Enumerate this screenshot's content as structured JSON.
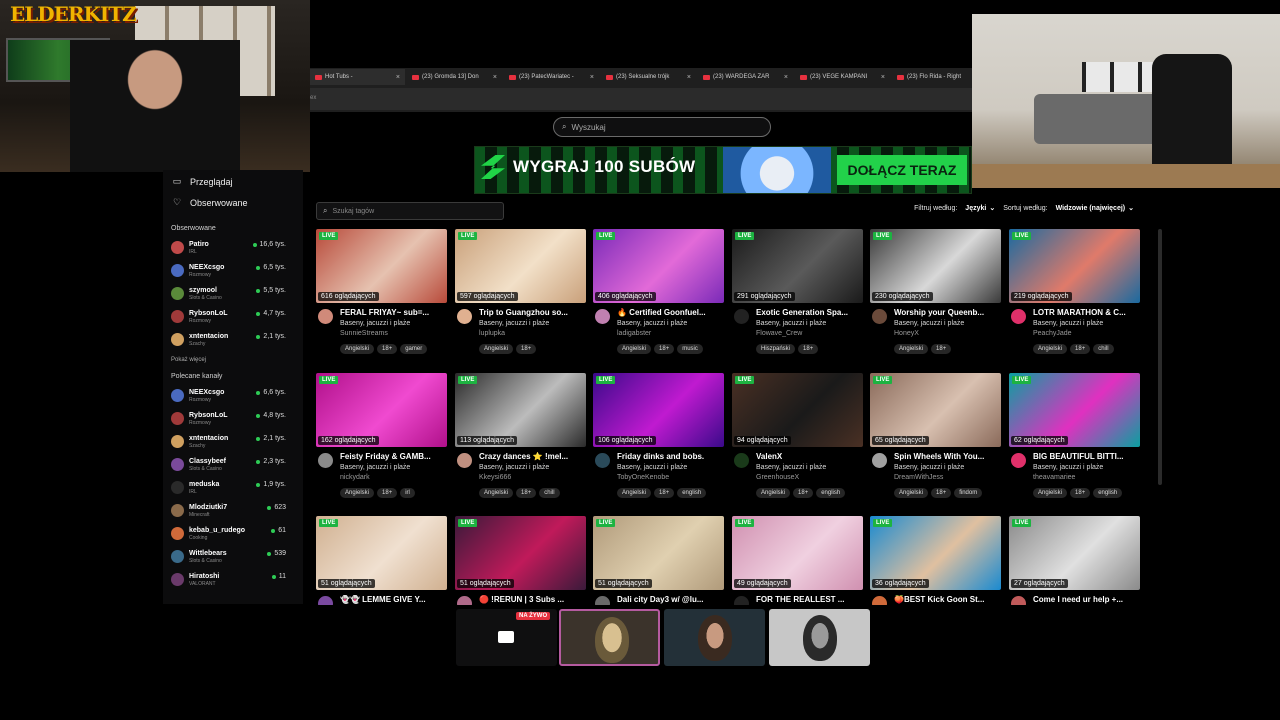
{
  "overlay": {
    "streamer_logo": "ELDERKITZ"
  },
  "browser": {
    "tabs": [
      {
        "label": "Hot Tubs - ",
        "active": true
      },
      {
        "label": "(23) Gromda 13] Don"
      },
      {
        "label": "(23) PatecWariatec - "
      },
      {
        "label": "(23) Seksualne trójk"
      },
      {
        "label": "(23) WARDEGA ZAR"
      },
      {
        "label": "(23) VEGE KAMPANI"
      },
      {
        "label": "(23) Flo Rida - Right "
      }
    ],
    "address_fragment": "ex"
  },
  "search": {
    "placeholder": "Wyszukaj"
  },
  "banner": {
    "headline": "WYGRAJ 100 SUBÓW",
    "cta": "DOŁĄCZ TERAZ",
    "accent": "#22d14a"
  },
  "sidebar": {
    "nav": [
      {
        "label": "Przeglądaj",
        "icon": "browse-icon"
      },
      {
        "label": "Obserwowane",
        "icon": "heart-icon"
      }
    ],
    "followed_header": "Obserwowane",
    "followed": [
      {
        "name": "Patiro",
        "category": "IRL",
        "viewers": "16,6 tys.",
        "color": "#c04a4a"
      },
      {
        "name": "NEEXcsgo",
        "category": "Rozmowy",
        "viewers": "6,5 tys.",
        "color": "#4a6ac0"
      },
      {
        "name": "szymool",
        "category": "Slots & Casino",
        "viewers": "5,5 tys.",
        "color": "#5a8a3a"
      },
      {
        "name": "RybsonLoL",
        "category": "Rozmowy",
        "viewers": "4,7 tys.",
        "color": "#a03a3a"
      },
      {
        "name": "xntentacion",
        "category": "Szachy",
        "viewers": "2,1 tys.",
        "color": "#d0a060"
      }
    ],
    "show_more": "Pokaż więcej",
    "recommended_header": "Polecane kanały",
    "recommended": [
      {
        "name": "NEEXcsgo",
        "category": "Rozmowy",
        "viewers": "6,6 tys.",
        "color": "#4a6ac0"
      },
      {
        "name": "RybsonLoL",
        "category": "Rozmowy",
        "viewers": "4,8 tys.",
        "color": "#a03a3a"
      },
      {
        "name": "xntentacion",
        "category": "Szachy",
        "viewers": "2,1 tys.",
        "color": "#d0a060"
      },
      {
        "name": "Classybeef",
        "category": "Slots & Casino",
        "viewers": "2,3 tys.",
        "color": "#7a4a9a"
      },
      {
        "name": "meduska",
        "category": "IRL",
        "viewers": "1,9 tys.",
        "color": "#2a2a2a"
      },
      {
        "name": "Mlodziutki7",
        "category": "Minecraft",
        "viewers": "623",
        "color": "#8a6a4a"
      },
      {
        "name": "kebab_u_rudego",
        "category": "Cooking",
        "viewers": "61",
        "color": "#d06a3a"
      },
      {
        "name": "Wittlebears",
        "category": "Slots & Casino",
        "viewers": "539",
        "color": "#3a6a8a"
      },
      {
        "name": "Hiratoshi",
        "category": "VALORANT",
        "viewers": "11",
        "color": "#6a3a6a"
      }
    ]
  },
  "filters": {
    "tag_search_placeholder": "Szukaj tagów",
    "filter_label": "Filtruj według:",
    "filter_value": "Języki",
    "sort_label": "Sortuj według:",
    "sort_value": "Widzowie (najwięcej)"
  },
  "live_label": "LIVE",
  "streams": [
    {
      "title": "FERAL FRIYAY~ sub=...",
      "category": "Baseny, jacuzzi i plaże",
      "user": "SunnieStreams",
      "viewers": "616 oglądających",
      "tags": [
        "Angielski",
        "18+",
        "gamer"
      ],
      "c1": "#b84a3a",
      "c2": "#e6c2b0",
      "av": "#d08a7a"
    },
    {
      "title": "Trip to Guangzhou so...",
      "category": "Baseny, jacuzzi i plaże",
      "user": "luplupka",
      "viewers": "597 oglądających",
      "tags": [
        "Angielski",
        "18+"
      ],
      "c1": "#c9a07a",
      "c2": "#f2e0c8",
      "av": "#e0b090"
    },
    {
      "title": "🔥 Certified Goonfuel...",
      "category": "Baseny, jacuzzi i plaże",
      "user": "ladigabster",
      "viewers": "406 oglądających",
      "tags": [
        "Angielski",
        "18+",
        "music"
      ],
      "c1": "#7a2ab8",
      "c2": "#e26ad8",
      "av": "#c080b0"
    },
    {
      "title": "Exotic Generation Spa...",
      "category": "Baseny, jacuzzi i plaże",
      "user": "Flowave_Crew",
      "viewers": "291 oglądających",
      "tags": [
        "Hiszpański",
        "18+"
      ],
      "c1": "#1a1a1a",
      "c2": "#5a5a5a",
      "av": "#222"
    },
    {
      "title": "Worship your Queenb...",
      "category": "Baseny, jacuzzi i plaże",
      "user": "HoneyX",
      "viewers": "230 oglądających",
      "tags": [
        "Angielski",
        "18+"
      ],
      "c1": "#3a3a3a",
      "c2": "#d8d8d8",
      "av": "#6a4a3a"
    },
    {
      "title": "LOTR MARATHON & C...",
      "category": "Baseny, jacuzzi i plaże",
      "user": "PeachyJade",
      "viewers": "219 oglądających",
      "tags": [
        "Angielski",
        "18+",
        "chill"
      ],
      "c1": "#1a6aa0",
      "c2": "#e07a6a",
      "av": "#e0306a"
    },
    {
      "title": "Feisty Friday & GAMB...",
      "category": "Baseny, jacuzzi i plaże",
      "user": "nickydark",
      "viewers": "162 oglądających",
      "tags": [
        "Angielski",
        "18+",
        "irl"
      ],
      "c1": "#b0108a",
      "c2": "#f04ad0",
      "av": "#8a8a8a"
    },
    {
      "title": "Crazy dances ⭐ !mel...",
      "category": "Baseny, jacuzzi i plaże",
      "user": "Kkeysi666",
      "viewers": "113 oglądających",
      "tags": [
        "Angielski",
        "18+",
        "chill"
      ],
      "c1": "#2a2a2a",
      "c2": "#bcbcbc",
      "av": "#c09080"
    },
    {
      "title": "Friday dinks and bobs.",
      "category": "Baseny, jacuzzi i plaże",
      "user": "TobyOneKenobe",
      "viewers": "106 oglądających",
      "tags": [
        "Angielski",
        "18+",
        "english"
      ],
      "c1": "#3a0a8a",
      "c2": "#c01ad0",
      "av": "#2a4a5a"
    },
    {
      "title": "ValenX",
      "category": "Baseny, jacuzzi i plaże",
      "user": "GreenhouseX",
      "viewers": "94 oglądających",
      "tags": [
        "Angielski",
        "18+",
        "english"
      ],
      "c1": "#4a3024",
      "c2": "#1a1a1a",
      "av": "#1a3a1a"
    },
    {
      "title": "Spin Wheels With You...",
      "category": "Baseny, jacuzzi i plaże",
      "user": "DreamWithJess",
      "viewers": "65 oglądających",
      "tags": [
        "Angielski",
        "18+",
        "findom"
      ],
      "c1": "#8a6a5a",
      "c2": "#d8c0b0",
      "av": "#a0a0a0"
    },
    {
      "title": "BIG BEAUTIFUL BITTI...",
      "category": "Baseny, jacuzzi i plaże",
      "user": "theavamariee",
      "viewers": "62 oglądających",
      "tags": [
        "Angielski",
        "18+",
        "english"
      ],
      "c1": "#0aa0a0",
      "c2": "#e030c0",
      "av": "#e0306a"
    },
    {
      "title": "👻👻 LEMME GIVE Y...",
      "category": "",
      "user": "",
      "viewers": "51 oglądających",
      "tags": [],
      "c1": "#d0b090",
      "c2": "#f0e0d0",
      "av": "#7a4aa0"
    },
    {
      "title": "🔴 !RERUN | 3 Subs ...",
      "category": "",
      "user": "",
      "viewers": "51 oglądających",
      "tags": [],
      "c1": "#3a1a3a",
      "c2": "#c01a5a",
      "av": "#b06a8a"
    },
    {
      "title": "Dali city Day3 w/ @lu...",
      "category": "",
      "user": "",
      "viewers": "51 oglądających",
      "tags": [],
      "c1": "#b09a7a",
      "c2": "#e0d0b0",
      "av": "#6a6a6a"
    },
    {
      "title": "FOR THE REALLEST ...",
      "category": "",
      "user": "",
      "viewers": "49 oglądających",
      "tags": [],
      "c1": "#d090b0",
      "c2": "#f0d0e0",
      "av": "#222"
    },
    {
      "title": "🍑BEST Kick Goon St...",
      "category": "",
      "user": "",
      "viewers": "36 oglądających",
      "tags": [],
      "c1": "#1a8ad0",
      "c2": "#e0c0a0",
      "av": "#d06a3a"
    },
    {
      "title": "Come I need ur help +...",
      "category": "",
      "user": "",
      "viewers": "27 oglądających",
      "tags": [],
      "c1": "#8a8a8a",
      "c2": "#e0e0e0",
      "av": "#c05a5a"
    }
  ],
  "guests": {
    "live_badge": "NA ŻYWO"
  }
}
